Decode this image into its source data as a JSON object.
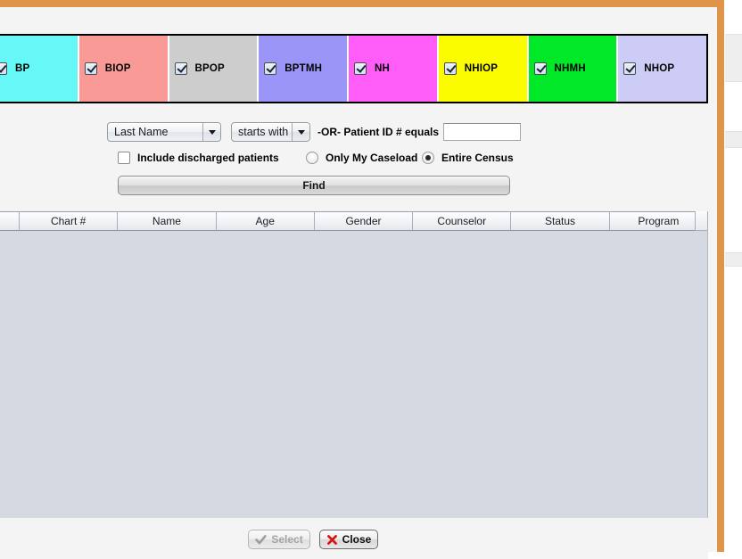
{
  "window": {
    "border_color": "#de9449",
    "background": "#f4f4f4"
  },
  "programs": {
    "items": [
      {
        "label": "BP",
        "color": "#66f7f7",
        "checked": true
      },
      {
        "label": "BIOP",
        "color": "#fa9a96",
        "checked": true
      },
      {
        "label": "BPOP",
        "color": "#cdcdcd",
        "checked": true
      },
      {
        "label": "BPTMH",
        "color": "#9a95f7",
        "checked": true
      },
      {
        "label": "NH",
        "color": "#ff5cf8",
        "checked": true
      },
      {
        "label": "NHIOP",
        "color": "#fcfc00",
        "checked": true
      },
      {
        "label": "NHMH",
        "color": "#00e827",
        "checked": true
      },
      {
        "label": "NHOP",
        "color": "#ccccf7",
        "checked": true
      }
    ]
  },
  "search": {
    "field_select": {
      "value": "Last Name"
    },
    "operator_select": {
      "value": "starts with"
    },
    "or_label": "-OR- Patient ID # equals",
    "patient_id": {
      "value": "",
      "placeholder": ""
    },
    "include_discharged": {
      "label": "Include discharged patients",
      "checked": false
    },
    "only_my_caseload": {
      "label": "Only My Caseload",
      "selected": false
    },
    "entire_census": {
      "label": "Entire Census",
      "selected": true
    },
    "find_button": {
      "label": "Find"
    }
  },
  "results": {
    "columns": [
      "",
      "Chart #",
      "Name",
      "Age",
      "Gender",
      "Counselor",
      "Status",
      "Program"
    ],
    "rows": []
  },
  "footer": {
    "select_button": {
      "label": "Select",
      "enabled": false,
      "icon": "checkmark-icon"
    },
    "close_button": {
      "label": "Close",
      "enabled": true,
      "icon": "red-x-icon"
    }
  }
}
